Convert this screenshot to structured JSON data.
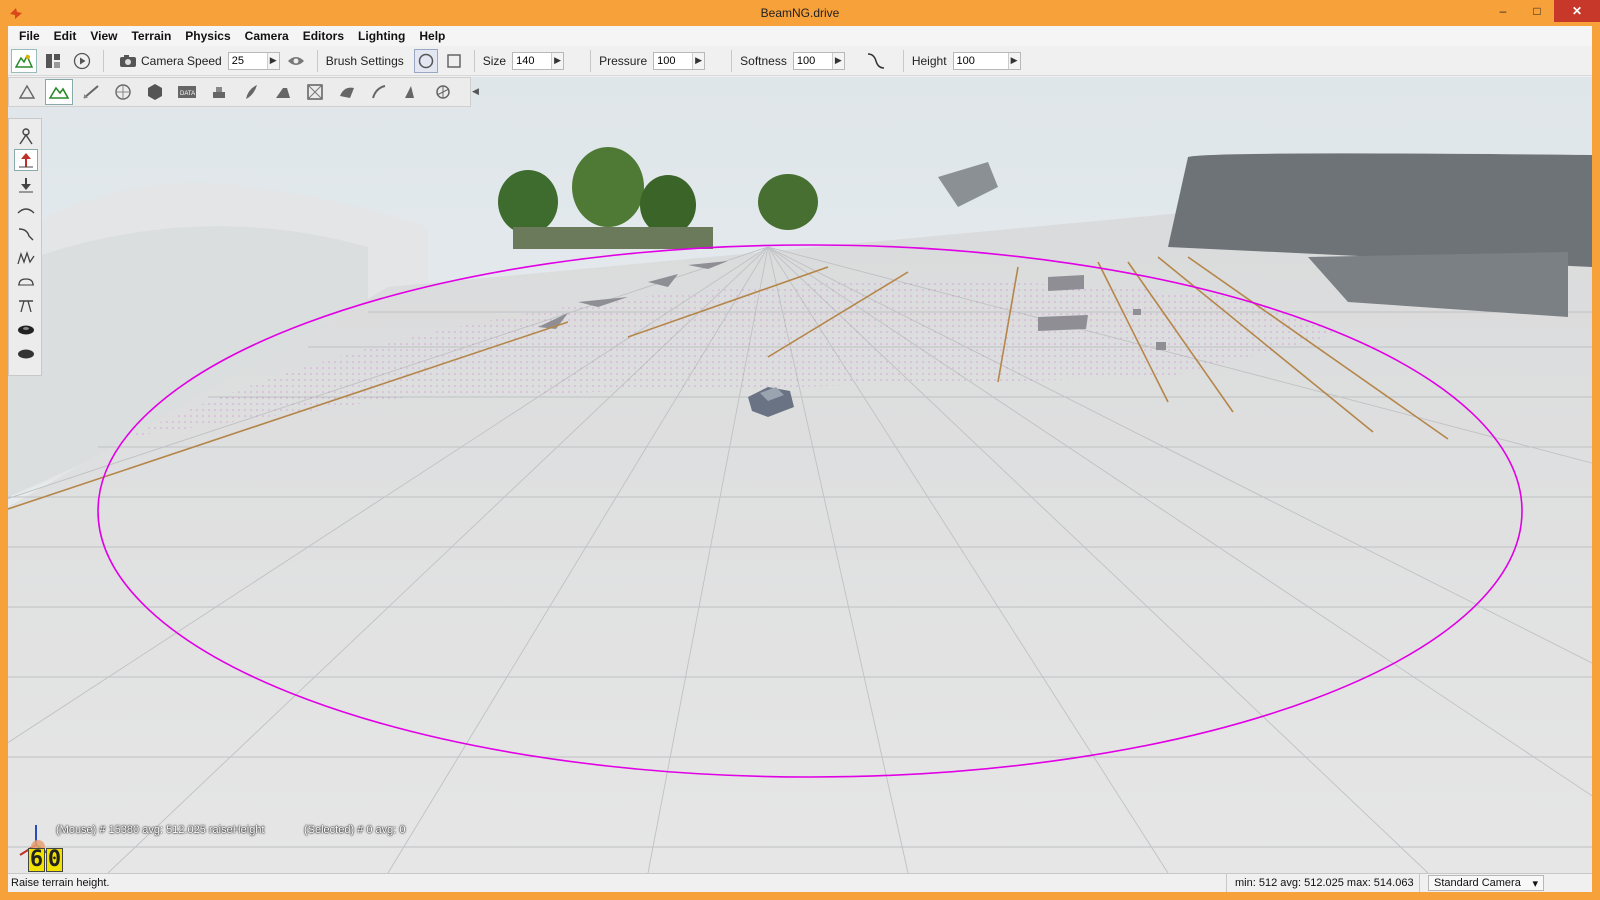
{
  "window": {
    "title": "BeamNG.drive",
    "controls": {
      "minimize": "–",
      "maximize": "□",
      "close": "✕"
    }
  },
  "menubar": {
    "items": [
      "File",
      "Edit",
      "View",
      "Terrain",
      "Physics",
      "Camera",
      "Editors",
      "Lighting",
      "Help"
    ]
  },
  "toolbar": {
    "camera_speed_label": "Camera Speed",
    "camera_speed_value": "25",
    "brush_settings_label": "Brush Settings",
    "size_label": "Size",
    "size_value": "140",
    "pressure_label": "Pressure",
    "pressure_value": "100",
    "softness_label": "Softness",
    "softness_value": "100",
    "height_label": "Height",
    "height_value": "100",
    "spin_glyph": "▶"
  },
  "editor_tools": [
    "world-editor-icon",
    "terrain-editor-icon",
    "terrain-painter-icon",
    "sky-icon",
    "object-icon",
    "datablock-icon",
    "decal-icon",
    "forest-icon",
    "mesh-road-icon",
    "convex-icon",
    "river-icon",
    "road-icon",
    "shape-icon",
    "node-icon"
  ],
  "left_palette": [
    "select-icon",
    "raise-height-icon",
    "lower-height-icon",
    "smooth-icon",
    "slope-icon",
    "noise-icon",
    "flatten-icon",
    "set-height-icon",
    "clear-holes-icon",
    "set-empty-icon"
  ],
  "overlay": {
    "mouse_info": "(Mouse) # 15380  avg: 512.025 raiseHeight",
    "selected_info": "(Selected) # 0  avg: 0",
    "fps_digits": [
      "6",
      "0"
    ]
  },
  "statusbar": {
    "hint": "Raise terrain height.",
    "stats": "min: 512  avg: 512.025  max: 514.063",
    "camera": "Standard Camera",
    "camera_arrow": "▾"
  },
  "colors": {
    "frame": "#f7a13a",
    "brush_ring": "#e100e6",
    "close": "#c7382b",
    "fps_bg": "#f2e200"
  }
}
